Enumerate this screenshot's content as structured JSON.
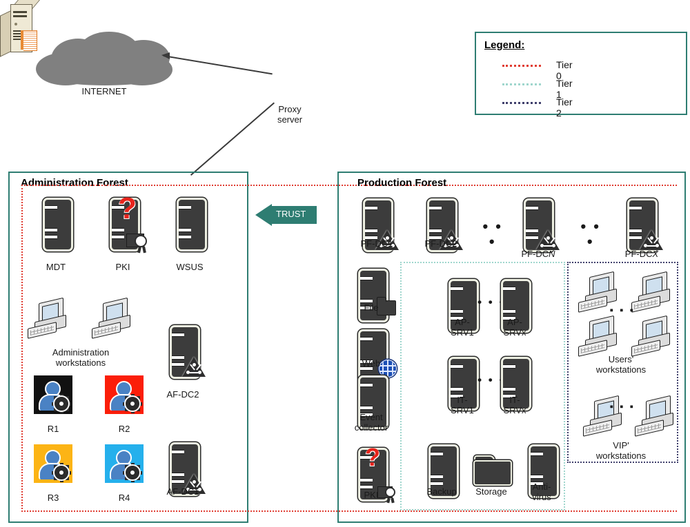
{
  "legend": {
    "title": "Legend:",
    "items": [
      {
        "label": "Tier 0",
        "color": "#e03c31"
      },
      {
        "label": "Tier 1",
        "color": "#9fd6cd"
      },
      {
        "label": "Tier 2",
        "color": "#3f3f6b"
      }
    ]
  },
  "internet": {
    "label": "INTERNET"
  },
  "proxy": {
    "label": "Proxy\nserver"
  },
  "trust": {
    "label": "TRUST"
  },
  "admin_forest": {
    "title": "Administration Forest",
    "servers": [
      {
        "label": "MDT",
        "type": "server"
      },
      {
        "label": "PKI",
        "type": "pki"
      },
      {
        "label": "WSUS",
        "type": "server"
      }
    ],
    "workstations": {
      "label": "Administration\nworkstations"
    },
    "domain_controllers": [
      {
        "label": "AF-DC2"
      },
      {
        "label": "AF-DC1"
      }
    ],
    "roles": [
      {
        "label": "R1",
        "color": "#111111"
      },
      {
        "label": "R2",
        "color": "#fb1e09"
      },
      {
        "label": "R3",
        "color": "#fcb415"
      },
      {
        "label": "R4",
        "color": "#25b0ec"
      }
    ]
  },
  "production_forest": {
    "title": "Production Forest",
    "domain_controllers": [
      {
        "label": "PF-DC1"
      },
      {
        "label": "PF-DC2"
      },
      {
        "label": "PF-DC",
        "italic": "N"
      },
      {
        "label": "PF-DC",
        "italic": "X"
      }
    ],
    "dc_ellipsis": [
      "• • •",
      "• • •"
    ],
    "services": [
      {
        "label": "File",
        "type": "file"
      },
      {
        "label": "Web",
        "type": "web"
      },
      {
        "label": "Event\ncollector",
        "type": "server"
      },
      {
        "label": "PKI",
        "type": "pki"
      }
    ],
    "tier1": {
      "app_servers": [
        {
          "label": "AP-\nSRV1"
        },
        {
          "label": "AP-\nSRVx"
        }
      ],
      "it_servers": [
        {
          "label": "IT-\nSRV1"
        },
        {
          "label": "IT-\nSRVx"
        }
      ],
      "row_ellipsis": "• • •",
      "infrastructure": [
        {
          "label": "Backup",
          "type": "server"
        },
        {
          "label": "Storage",
          "type": "storage"
        },
        {
          "label": "Anti-\nvirus",
          "type": "server"
        }
      ]
    },
    "tier2": {
      "users": {
        "label": "Users'\nworkstations",
        "count": 4,
        "ellipsis": "▪ ▪ ▪"
      },
      "vip": {
        "label": "VIP'\nworkstations",
        "count": 2,
        "ellipsis": "▪ ▪ ▪"
      }
    }
  }
}
